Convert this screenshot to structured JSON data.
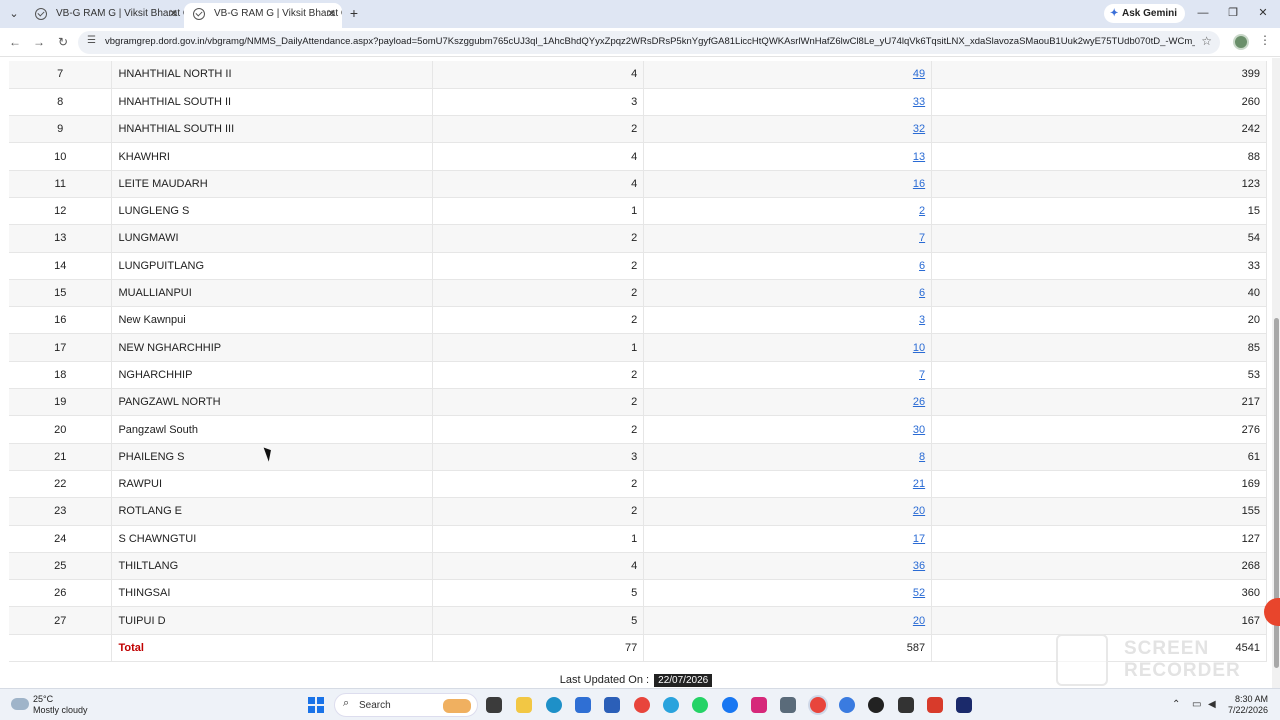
{
  "browser": {
    "tabs": [
      {
        "title": "VB-G RAM G | Viksit Bharat Gua",
        "active": false
      },
      {
        "title": "VB-G RAM G | Viksit Bharat Gua",
        "active": true
      }
    ],
    "ask_gemini": "Ask Gemini",
    "url": "vbgramgrep.dord.gov.in/vbgramg/NMMS_DailyAttendance.aspx?payload=5omU7Kszggubm765cUJ3ql_1AhcBhdQYyxZpqz2WRsDRsP5knYgyfGA81LiccHtQWKAsrlWnHafZ6lwCl8Le_yU74lqVk6TqsitLNX_xdaSlavozaSMaouB1Uuk2wyE75TUdb070tD_-WCm_C8nOOXfT..."
  },
  "table": {
    "rows": [
      {
        "sno": "7",
        "name": "HNAHTHIAL NORTH II",
        "col3": "4",
        "col4": "49",
        "col5": "399"
      },
      {
        "sno": "8",
        "name": "HNAHTHIAL SOUTH II",
        "col3": "3",
        "col4": "33",
        "col5": "260"
      },
      {
        "sno": "9",
        "name": "HNAHTHIAL SOUTH III",
        "col3": "2",
        "col4": "32",
        "col5": "242"
      },
      {
        "sno": "10",
        "name": "KHAWHRI",
        "col3": "4",
        "col4": "13",
        "col5": "88"
      },
      {
        "sno": "11",
        "name": "LEITE MAUDARH",
        "col3": "4",
        "col4": "16",
        "col5": "123"
      },
      {
        "sno": "12",
        "name": "LUNGLENG S",
        "col3": "1",
        "col4": "2",
        "col5": "15"
      },
      {
        "sno": "13",
        "name": "LUNGMAWI",
        "col3": "2",
        "col4": "7",
        "col5": "54"
      },
      {
        "sno": "14",
        "name": "LUNGPUITLANG",
        "col3": "2",
        "col4": "6",
        "col5": "33"
      },
      {
        "sno": "15",
        "name": "MUALLIANPUI",
        "col3": "2",
        "col4": "6",
        "col5": "40"
      },
      {
        "sno": "16",
        "name": "New Kawnpui",
        "col3": "2",
        "col4": "3",
        "col5": "20"
      },
      {
        "sno": "17",
        "name": "NEW NGHARCHHIP",
        "col3": "1",
        "col4": "10",
        "col5": "85"
      },
      {
        "sno": "18",
        "name": "NGHARCHHIP",
        "col3": "2",
        "col4": "7",
        "col5": "53"
      },
      {
        "sno": "19",
        "name": "PANGZAWL NORTH",
        "col3": "2",
        "col4": "26",
        "col5": "217"
      },
      {
        "sno": "20",
        "name": "Pangzawl South",
        "col3": "2",
        "col4": "30",
        "col5": "276"
      },
      {
        "sno": "21",
        "name": "PHAILENG S",
        "col3": "3",
        "col4": "8",
        "col5": "61"
      },
      {
        "sno": "22",
        "name": "RAWPUI",
        "col3": "2",
        "col4": "21",
        "col5": "169"
      },
      {
        "sno": "23",
        "name": "ROTLANG E",
        "col3": "2",
        "col4": "20",
        "col5": "155"
      },
      {
        "sno": "24",
        "name": "S CHAWNGTUI",
        "col3": "1",
        "col4": "17",
        "col5": "127"
      },
      {
        "sno": "25",
        "name": "THILTLANG",
        "col3": "4",
        "col4": "36",
        "col5": "268"
      },
      {
        "sno": "26",
        "name": "THINGSAI",
        "col3": "5",
        "col4": "52",
        "col5": "360"
      },
      {
        "sno": "27",
        "name": "TUIPUI D",
        "col3": "5",
        "col4": "20",
        "col5": "167"
      }
    ],
    "total": {
      "label": "Total",
      "col3": "77",
      "col4": "587",
      "col5": "4541"
    }
  },
  "footer": {
    "last_updated_label": "Last Updated On :",
    "last_updated_date": "22/07/2026"
  },
  "watermark": {
    "line1": "SCREEN",
    "line2": "RECORDER"
  },
  "taskbar": {
    "temperature": "25°C",
    "weather": "Mostly cloudy",
    "search_label": "Search",
    "time": "8:30 AM",
    "date": "7/22/2026"
  },
  "colors": {
    "link": "#2a6bd4",
    "total_label": "#c00000",
    "row_alt": "#f7f7f7"
  }
}
